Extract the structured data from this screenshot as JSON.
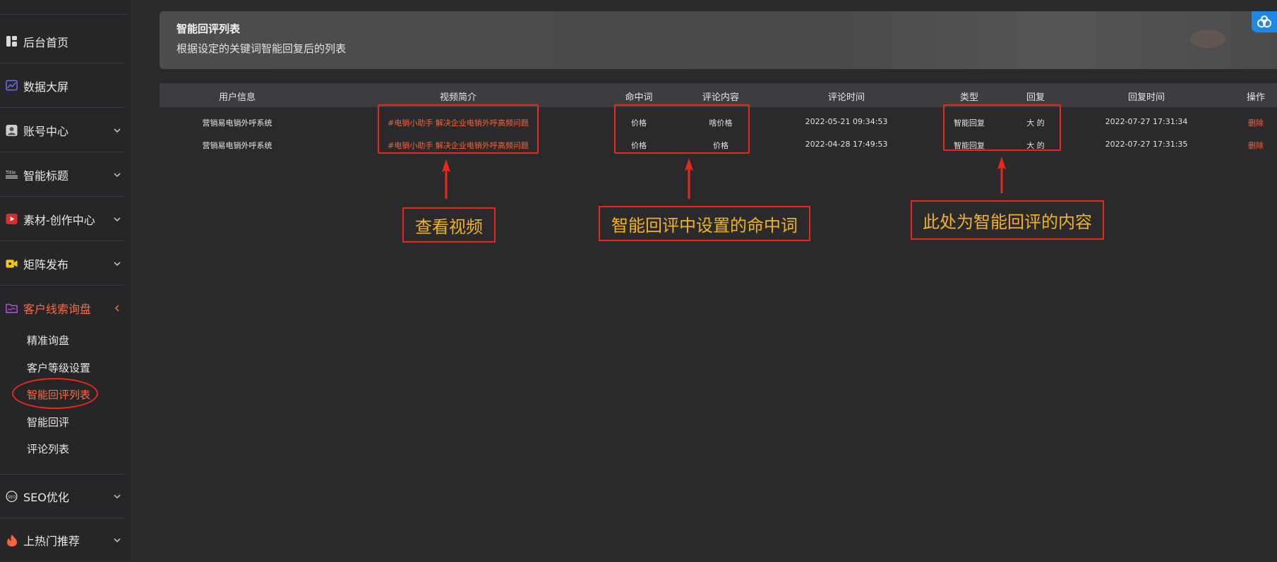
{
  "sidebar": {
    "items": [
      {
        "label": "后台首页"
      },
      {
        "label": "数据大屏"
      },
      {
        "label": "账号中心"
      },
      {
        "label": "智能标题"
      },
      {
        "label": "素材-创作中心"
      },
      {
        "label": "矩阵发布"
      },
      {
        "label": "客户线索询盘"
      },
      {
        "label": "SEO优化"
      },
      {
        "label": "上热门推荐"
      }
    ],
    "sub_items": [
      {
        "label": "精准询盘"
      },
      {
        "label": "客户等级设置"
      },
      {
        "label": "智能回评列表"
      },
      {
        "label": "智能回评"
      },
      {
        "label": "评论列表"
      }
    ],
    "active_item": "客户线索询盘",
    "active_sub_item": "智能回评列表"
  },
  "header": {
    "title": "智能回评列表",
    "subtitle": "根据设定的关键词智能回复后的列表"
  },
  "table": {
    "columns": [
      "用户信息",
      "视频简介",
      "命中词",
      "评论内容",
      "评论时间",
      "类型",
      "回复",
      "回复时间",
      "操作"
    ],
    "rows": [
      {
        "user": "营销易电销外呼系统",
        "video": "#电销小助手 解决企业电销外呼高频问题",
        "hit_word": "价格",
        "comment": "啥价格",
        "comment_time": "2022-05-21 09:34:53",
        "type": "智能回复",
        "reply": "大 的",
        "reply_time": "2022-07-27 17:31:34",
        "action": "删除"
      },
      {
        "user": "营销易电销外呼系统",
        "video": "#电销小助手 解决企业电销外呼高频问题",
        "hit_word": "价格",
        "comment": "价格",
        "comment_time": "2022-04-28 17:49:53",
        "type": "智能回复",
        "reply": "大 的",
        "reply_time": "2022-07-27 17:31:35",
        "action": "删除"
      }
    ]
  },
  "annotations": {
    "video": "查看视频",
    "hit_word": "智能回评中设置的命中词",
    "reply": "此处为智能回评的内容"
  },
  "colors": {
    "accent": "#f56c4a",
    "annotation_red": "#e8281b",
    "annotation_text": "#f2b21f",
    "background": "#2a2a2c",
    "corner_badge": "#1e88e5"
  }
}
